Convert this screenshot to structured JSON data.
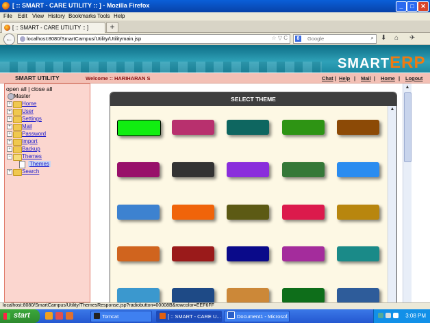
{
  "window": {
    "title": "[ :: SMART - CARE UTILITY :: ] - Mozilla Firefox",
    "minimize": "_",
    "maximize": "□",
    "close": "✕"
  },
  "menu": [
    "File",
    "Edit",
    "View",
    "History",
    "Bookmarks",
    "Tools",
    "Help"
  ],
  "tab": {
    "title": "[ :: SMART - CARE UTILITY :: ]",
    "new_tab": "+"
  },
  "nav": {
    "back": "←",
    "url": "localhost:8080/SmartCampus/Utility/Utilitymain.jsp",
    "url_icons": "☆ ▽ C",
    "search_engine": "8",
    "search_placeholder": "Google",
    "search_icon": "⌕",
    "download_icon": "⬇",
    "home_icon": "⌂"
  },
  "logo": {
    "smart": "SMART",
    "erp": "ERP"
  },
  "app_header": {
    "name": "SMART UTILITY",
    "welcome": "Welcome :: HARIHARAN S",
    "links": [
      "Chat",
      "Help",
      "Mail",
      "Home",
      "Logout"
    ],
    "separator": "|"
  },
  "tree": {
    "open_close": "open all | close all",
    "root": "Master",
    "items": [
      "Home",
      "User",
      "Settings",
      "Mail",
      "Password",
      "Import",
      "Backup",
      "Themes",
      "Search"
    ],
    "child": "Themes"
  },
  "theme_panel": {
    "title": "SELECT THEME",
    "scroll_up": "▲",
    "colors": [
      "#11ee11",
      "#b8306e",
      "#0e6660",
      "#2e9414",
      "#8c4a06",
      "#98106a",
      "#333333",
      "#8a2edc",
      "#357838",
      "#2a8cf0",
      "#3d82d0",
      "#f0640a",
      "#5c5a14",
      "#dc1a4c",
      "#b8860e",
      "#d0641e",
      "#9a1a1a",
      "#0a0a8a",
      "#a42c9c",
      "#1a8a88",
      "#3b98ce",
      "#1e4a86",
      "#cc8838",
      "#0e6e1a",
      "#2e5c9a"
    ]
  },
  "status_bar": "localhost:8080/SmartCampus/Utility/ThemesResponse.jsp?radiobutton=00008B&rowcolor=EEF6FF",
  "taskbar": {
    "start": "start",
    "items": [
      "Tomcat",
      "[ :: SMART - CARE U...",
      "Document1 - Microsof..."
    ],
    "clock": "3:08 PM"
  },
  "colors": {
    "accent": "#f07a10",
    "panel_header": "#3e3e3e",
    "sidebar_bg": "#fbd6cf",
    "banner": "#2fa1b8"
  }
}
